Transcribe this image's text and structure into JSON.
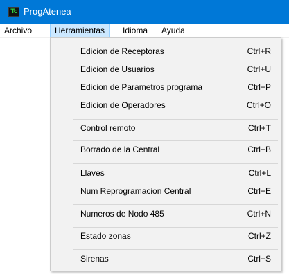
{
  "window": {
    "title": "ProgAtenea",
    "icon_name": "app-logo-icon",
    "icon_text": "Tc",
    "titlebar_color": "#0078d7"
  },
  "menubar": {
    "items": [
      {
        "label": "Archivo"
      },
      {
        "label": "Herramientas",
        "active": true
      },
      {
        "label": "Idioma"
      },
      {
        "label": "Ayuda"
      }
    ]
  },
  "dropdown": {
    "items": [
      {
        "label": "Edicion de Receptoras",
        "shortcut": "Ctrl+R"
      },
      {
        "label": "Edicion de Usuarios",
        "shortcut": "Ctrl+U"
      },
      {
        "label": "Edicion de Parametros programa",
        "shortcut": "Ctrl+P"
      },
      {
        "label": "Edicion de Operadores",
        "shortcut": "Ctrl+O"
      },
      {
        "label": "Control remoto",
        "shortcut": "Ctrl+T"
      },
      {
        "label": "Borrado de la Central",
        "shortcut": "Ctrl+B"
      },
      {
        "label": "Llaves",
        "shortcut": "Ctrl+L"
      },
      {
        "label": "Num Reprogramacion Central",
        "shortcut": "Ctrl+E"
      },
      {
        "label": "Numeros de Nodo 485",
        "shortcut": "Ctrl+N"
      },
      {
        "label": "Estado zonas",
        "shortcut": "Ctrl+Z"
      },
      {
        "label": "Sirenas",
        "shortcut": "Ctrl+S"
      }
    ]
  }
}
